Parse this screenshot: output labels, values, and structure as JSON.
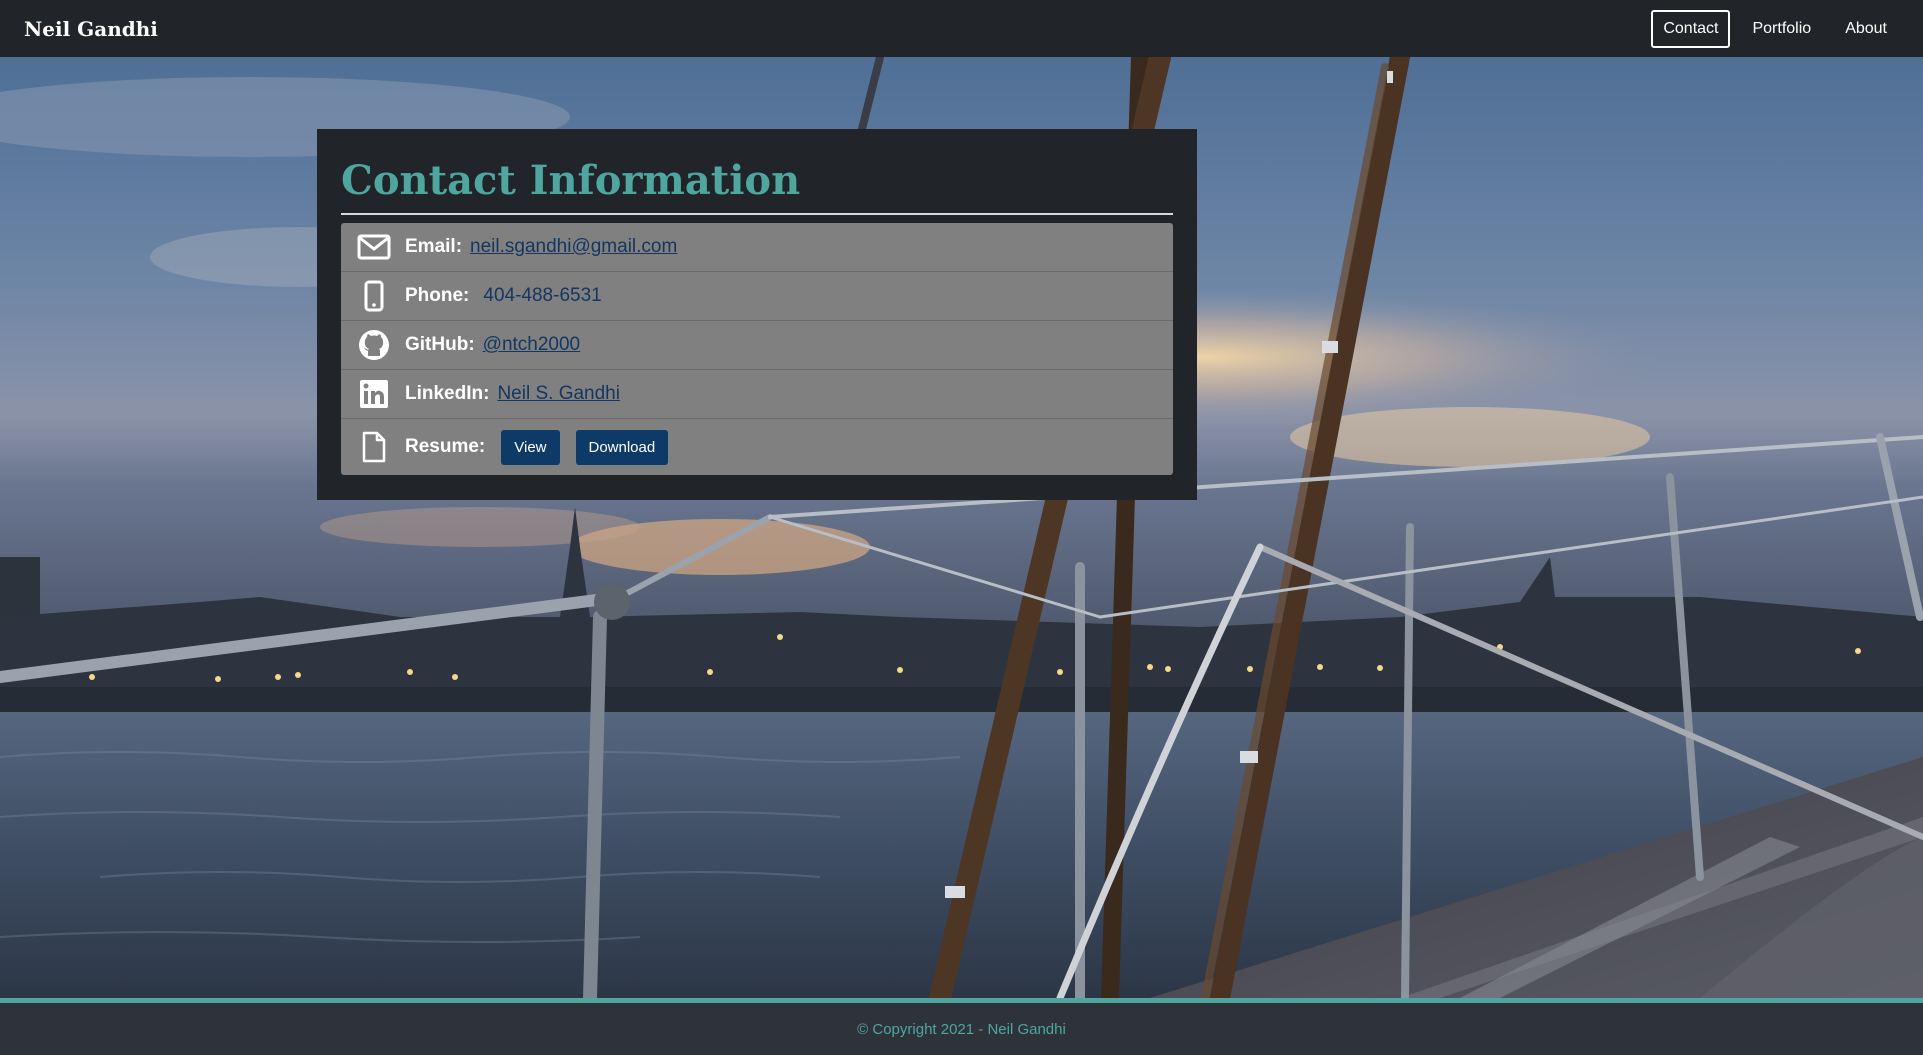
{
  "navbar": {
    "brand": "Neil Gandhi",
    "links": [
      {
        "label": "Contact",
        "active": true
      },
      {
        "label": "Portfolio",
        "active": false
      },
      {
        "label": "About",
        "active": false
      }
    ]
  },
  "contact": {
    "title": "Contact Information",
    "email": {
      "label": "Email:",
      "value": "neil.sgandhi@gmail.com",
      "icon": "envelope-icon"
    },
    "phone": {
      "label": "Phone:",
      "value": "404-488-6531",
      "icon": "phone-icon"
    },
    "github": {
      "label": "GitHub:",
      "value": "@ntch2000",
      "icon": "github-icon"
    },
    "linkedin": {
      "label": "LinkedIn:",
      "value": "Neil S. Gandhi",
      "icon": "linkedin-icon"
    },
    "resume": {
      "label": "Resume:",
      "view_label": "View",
      "download_label": "Download",
      "icon": "document-icon"
    }
  },
  "footer": {
    "copyright": "© Copyright 2021 - Neil Gandhi"
  },
  "colors": {
    "accent": "#4ea69e",
    "navbar_bg": "#212429",
    "card_bg": "#212429",
    "list_bg": "#808080",
    "button_bg": "#0d3a66",
    "link_color": "#14365f"
  }
}
